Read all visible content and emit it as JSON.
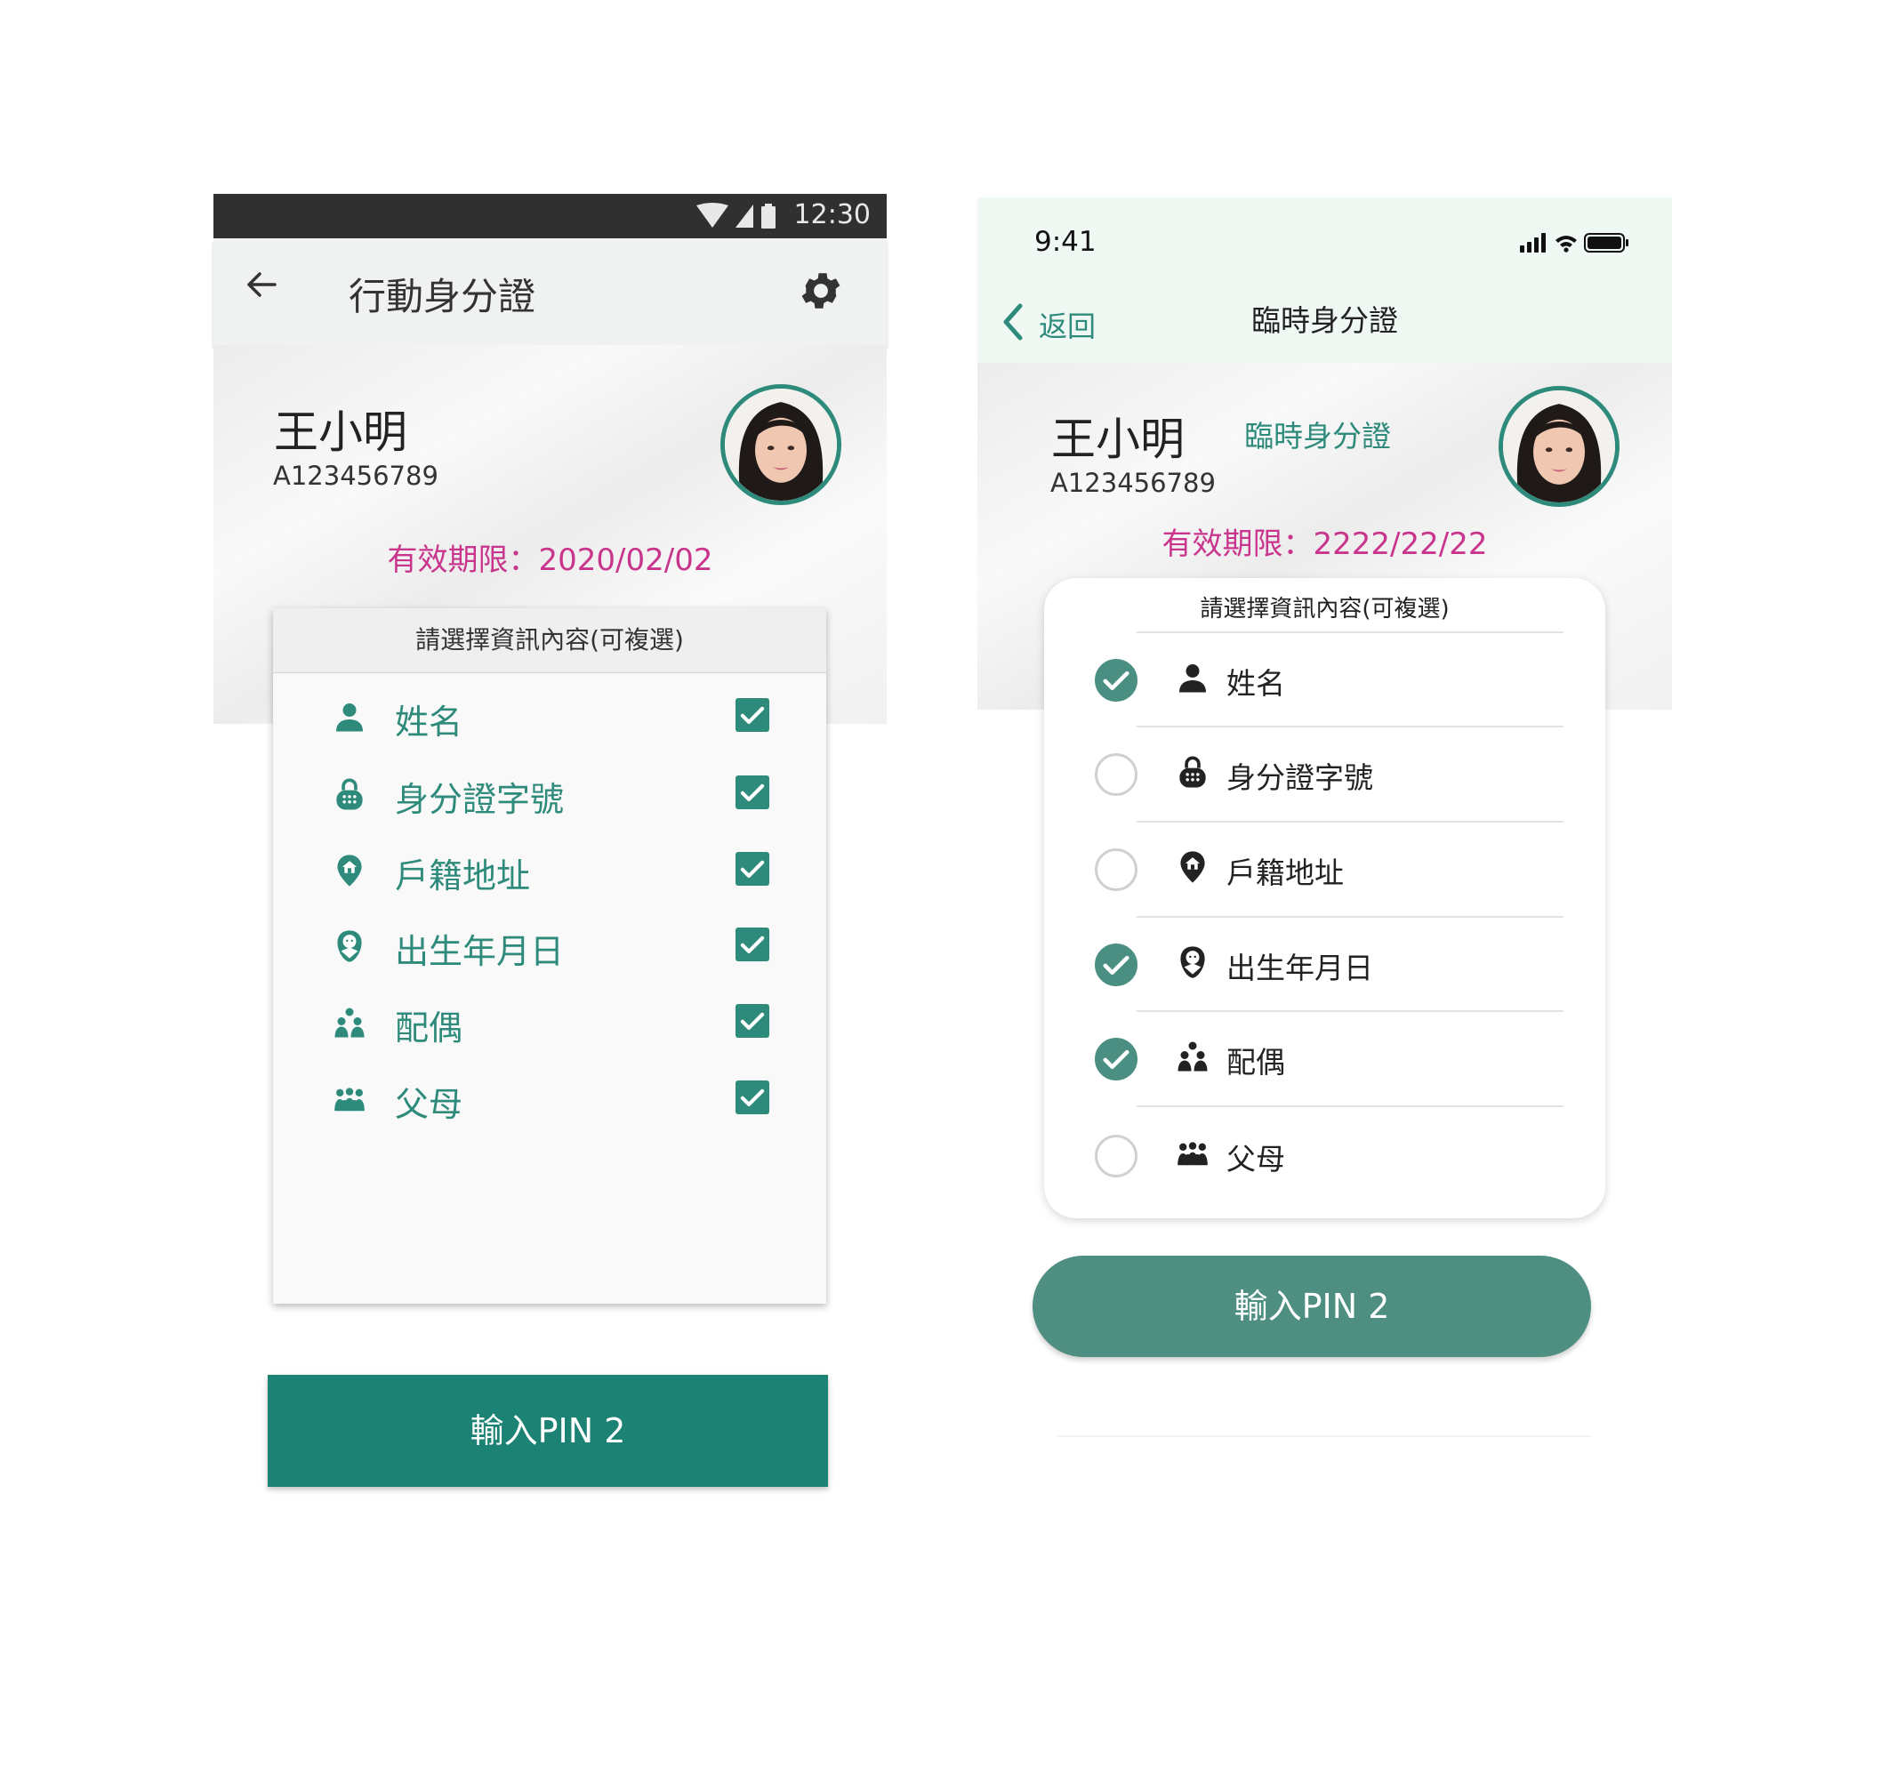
{
  "android": {
    "status_time": "12:30",
    "app_title": "行動身分證",
    "name": "王小明",
    "id_number": "A123456789",
    "expiry": "有效期限：2020/02/02",
    "panel_title": "請選擇資訊內容(可複選)",
    "items": [
      {
        "label": "姓名",
        "icon": "person-icon",
        "checked": true
      },
      {
        "label": "身分證字號",
        "icon": "id-lock-icon",
        "checked": true
      },
      {
        "label": "戶籍地址",
        "icon": "home-pin-icon",
        "checked": true
      },
      {
        "label": "出生年月日",
        "icon": "baby-icon",
        "checked": true
      },
      {
        "label": "配偶",
        "icon": "couple-icon",
        "checked": true
      },
      {
        "label": "父母",
        "icon": "family-icon",
        "checked": true
      }
    ],
    "pin_button": "輸入PIN 2"
  },
  "ios": {
    "status_time": "9:41",
    "back_label": "返回",
    "app_title": "臨時身分證",
    "name": "王小明",
    "tag": "臨時身分證",
    "id_number": "A123456789",
    "expiry": "有效期限：2222/22/22",
    "panel_title": "請選擇資訊內容(可複選)",
    "items": [
      {
        "label": "姓名",
        "icon": "person-icon",
        "checked": true
      },
      {
        "label": "身分證字號",
        "icon": "id-lock-icon",
        "checked": false
      },
      {
        "label": "戶籍地址",
        "icon": "home-pin-icon",
        "checked": false
      },
      {
        "label": "出生年月日",
        "icon": "baby-icon",
        "checked": true
      },
      {
        "label": "配偶",
        "icon": "couple-icon",
        "checked": true
      },
      {
        "label": "父母",
        "icon": "family-icon",
        "checked": false
      }
    ],
    "pin_button": "輸入PIN 2"
  },
  "colors": {
    "accent": "#2e8b7c",
    "android_button": "#1b8274",
    "ios_button": "#4e8f82",
    "expiry": "#c9358d"
  }
}
